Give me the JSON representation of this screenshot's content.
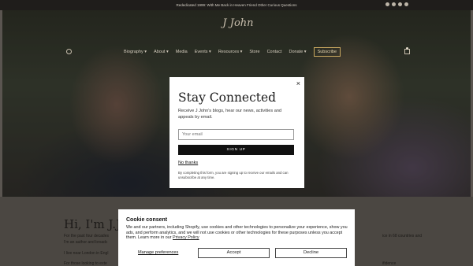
{
  "topbar": {
    "announcement": "Rededicated 1999: With Me Back in Heaven Friend Other Curious Questions"
  },
  "header": {
    "logo_text": "J John",
    "nav": [
      "Biography ▾",
      "About ▾",
      "Media",
      "Events ▾",
      "Resources ▾",
      "Store",
      "Contact",
      "Donate ▾"
    ],
    "subscribe": "Subscribe"
  },
  "intro": {
    "heading": "Hi, I'm J.J.",
    "line1": "For the past four decades",
    "line1_right": "ice in 68 countries and",
    "line2": "I'm an author and broadc",
    "line3": "I live near London in Engl",
    "line4": "For those looking to exte",
    "line4_right": "ifidence"
  },
  "modal": {
    "title": "Stay Connected",
    "subtitle": "Receive J John's blogs, hear our news, activities and appeals by email.",
    "email_placeholder": "Your email",
    "signup": "SIGN UP",
    "no_thanks": "No thanks",
    "disclaimer": "By completing this form, you are signing up to receive our emails and can unsubscribe at any time.",
    "close": "×"
  },
  "cookie": {
    "title": "Cookie consent",
    "text": "We and our partners, including Shopify, use cookies and other technologies to personalize your experience, show you ads, and perform analytics, and we will not use cookies or other technologies for these purposes unless you accept them. Learn more in our ",
    "policy_link": "Privacy Policy",
    "manage": "Manage preferences",
    "accept": "Accept",
    "decline": "Decline"
  }
}
